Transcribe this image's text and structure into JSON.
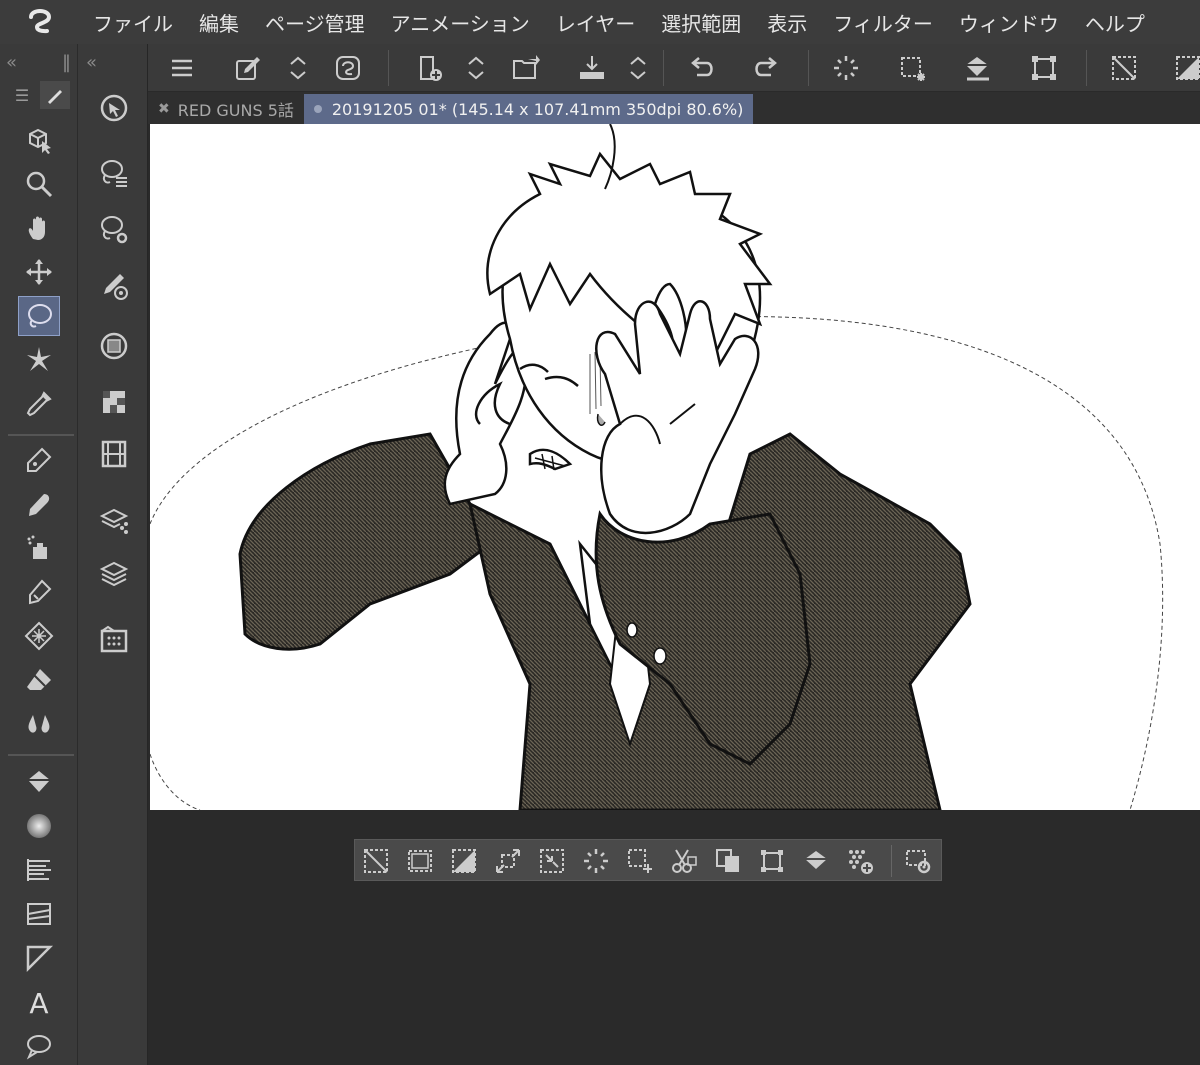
{
  "app": {
    "menu": [
      "ファイル",
      "編集",
      "ページ管理",
      "アニメーション",
      "レイヤー",
      "選択範囲",
      "表示",
      "フィルター",
      "ウィンドウ",
      "ヘルプ"
    ]
  },
  "tools": {
    "active": "lasso-selection-tool",
    "colors": {
      "active_bg": "#5a6786",
      "panel_bg": "#3a3a3a",
      "canvas_bg": "#ffffff"
    }
  },
  "tabs": [
    {
      "label": "RED GUNS 5話",
      "state": "inactive"
    },
    {
      "label": "20191205 01* (145.14 x 107.41mm 350dpi 80.6%)",
      "state": "active"
    }
  ],
  "canvas": {
    "zoom": "80.6%",
    "selection": "lasso ellipse (marching ants)"
  }
}
